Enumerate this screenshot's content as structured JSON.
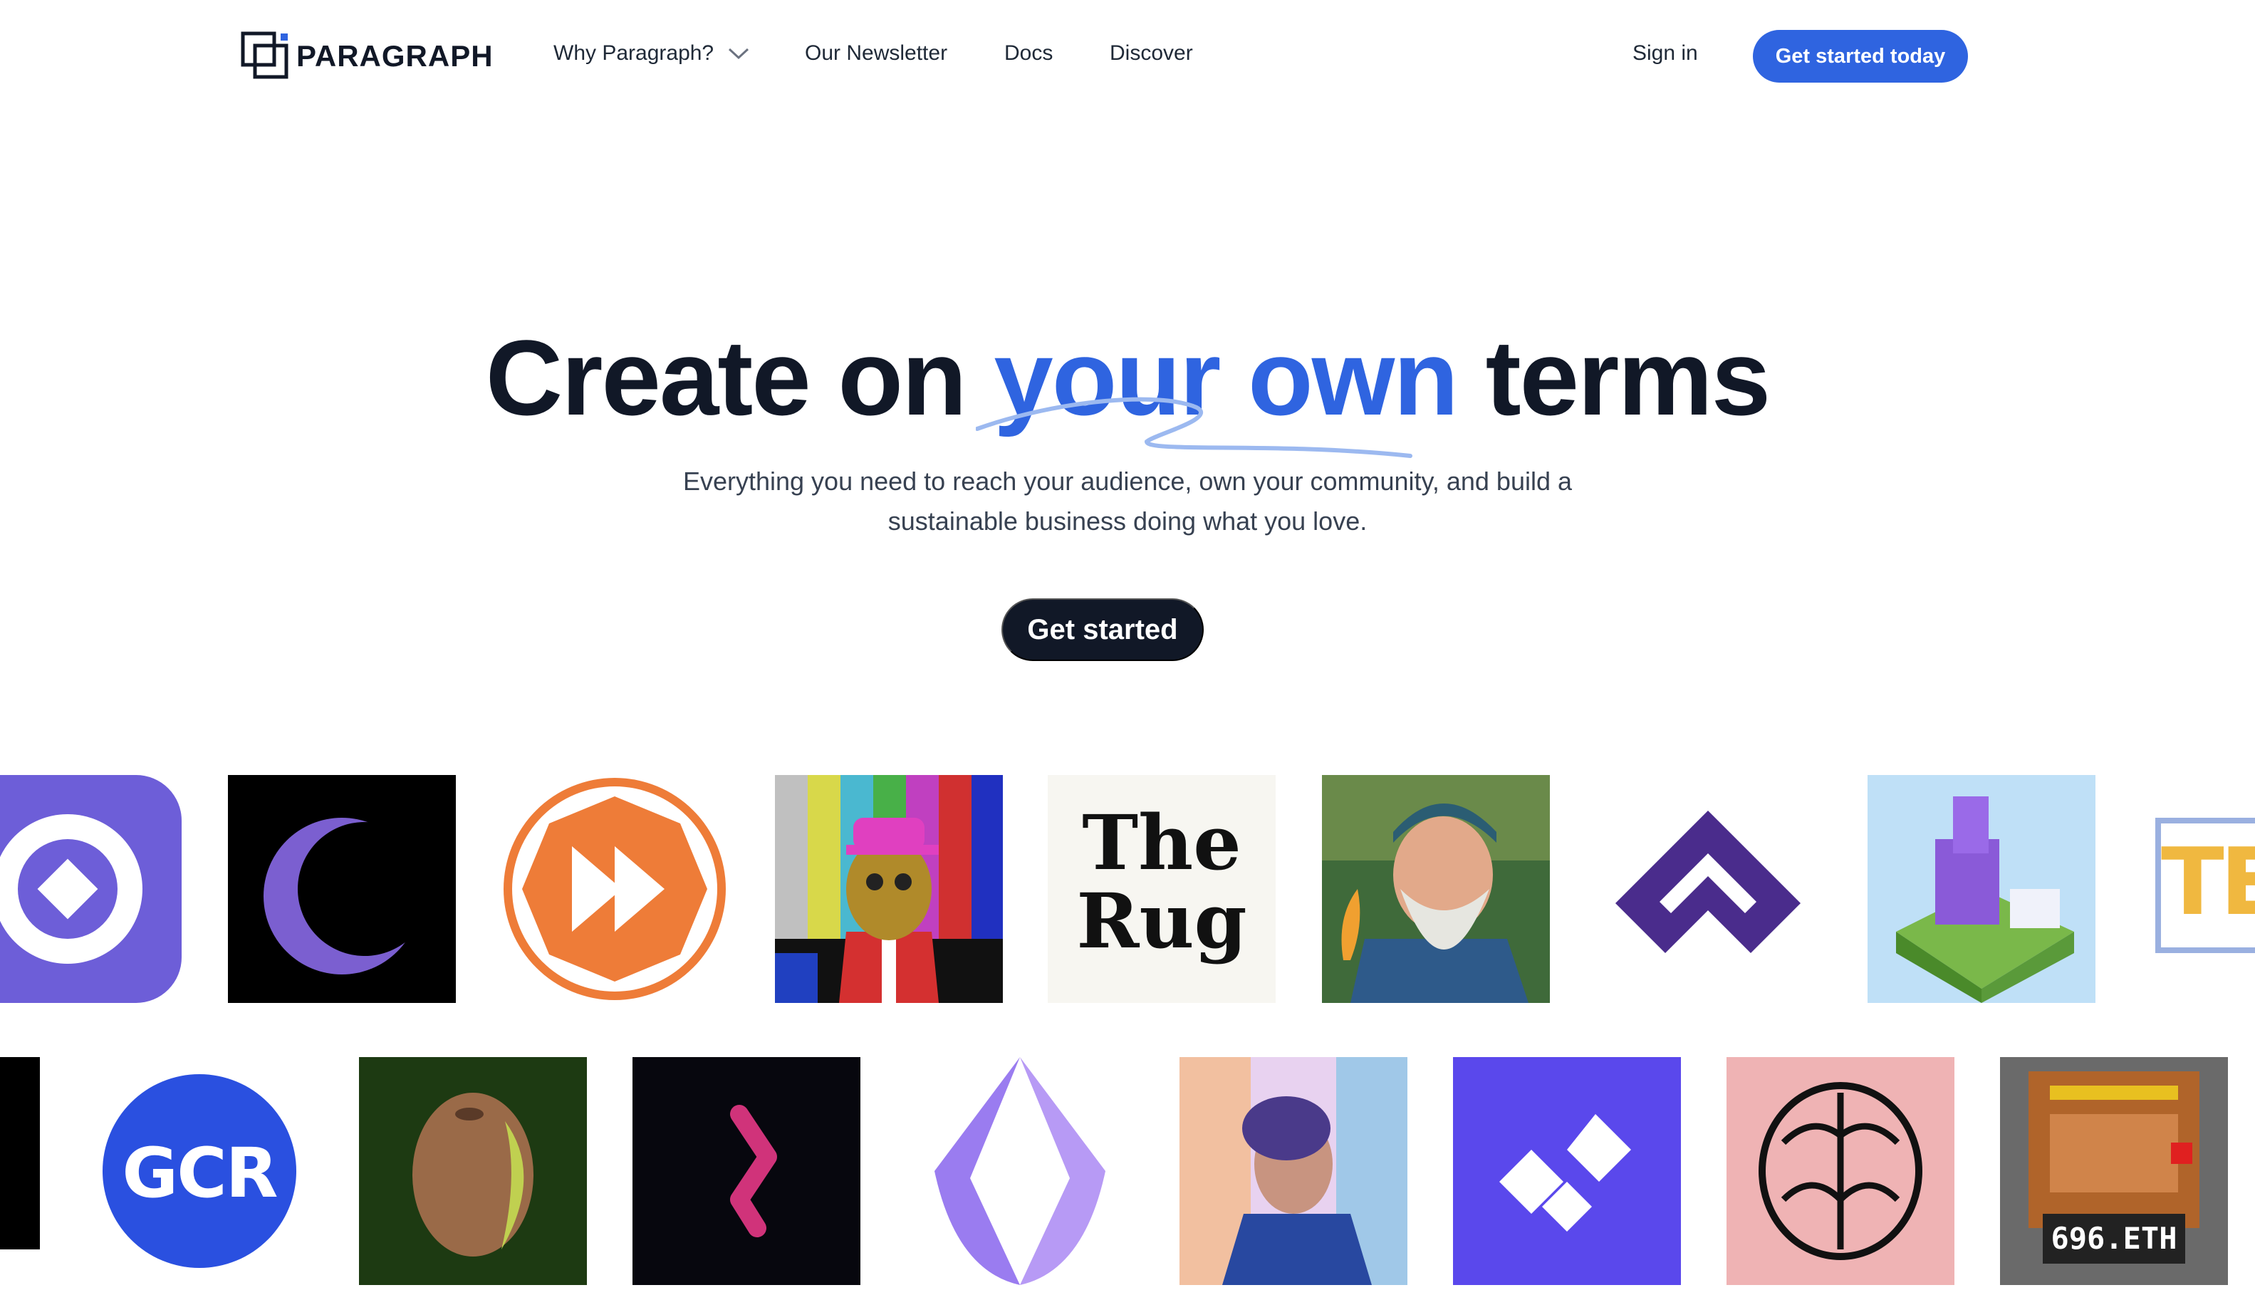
{
  "brand": {
    "name": "PARAGRAPH"
  },
  "nav": {
    "why": "Why Paragraph?",
    "newsletter": "Our Newsletter",
    "docs": "Docs",
    "discover": "Discover",
    "sign_in": "Sign in",
    "cta": "Get started today"
  },
  "hero": {
    "title_start": "Create on ",
    "title_accent": "your own",
    "title_end": " terms",
    "subtitle_line1": "Everything you need to reach your audience, own your community, and build a",
    "subtitle_line2": "sustainable business doing what you love.",
    "cta": "Get started"
  },
  "gallery": {
    "the_rug_line1": "The",
    "the_rug_line2": "Rug",
    "gcr": "GCR",
    "ens_tile": "696.ETH",
    "partial_tile": "TE"
  },
  "colors": {
    "accent": "#2f64e0",
    "dark": "#111827"
  }
}
